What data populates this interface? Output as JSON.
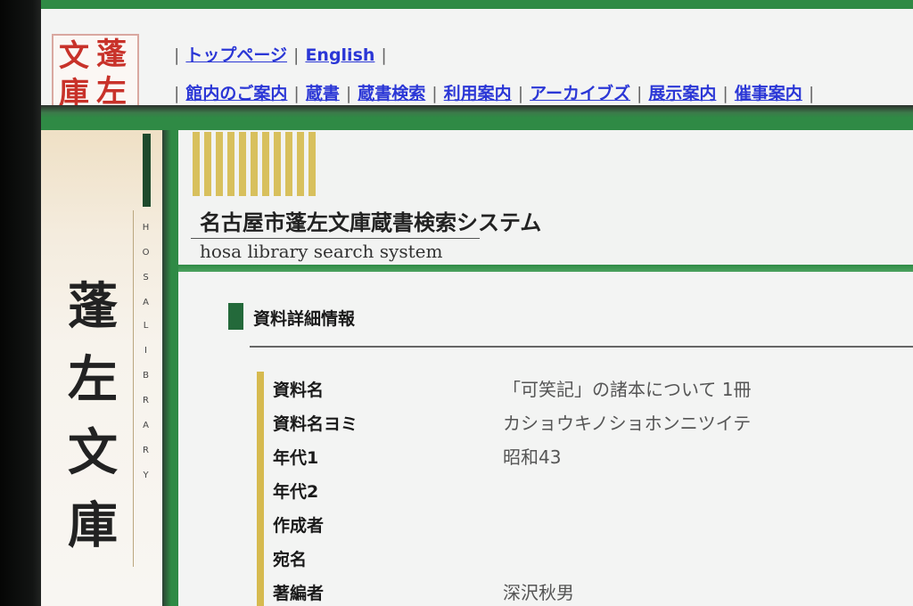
{
  "logo": {
    "chars": [
      "文",
      "蓬",
      "庫",
      "左"
    ]
  },
  "nav": {
    "top_links": [
      "トップページ",
      "English"
    ],
    "main_links": [
      "館内のご案内",
      "蔵書",
      "蔵書検索",
      "利用案内",
      "アーカイブズ",
      "展示案内",
      "催事案内"
    ]
  },
  "sidebar": {
    "vertical_text": [
      "H",
      "O",
      "S",
      "A",
      "L",
      "I",
      "B",
      "R",
      "A",
      "R",
      "Y"
    ],
    "kanji": [
      "蓬",
      "左",
      "文",
      "庫"
    ]
  },
  "system": {
    "title_jp": "名古屋市蓬左文庫蔵書検索システム",
    "title_en": "hosa library search system"
  },
  "section": {
    "title": "資料詳細情報"
  },
  "details": [
    {
      "label": "資料名",
      "value": "「可笑記」の諸本について 1冊"
    },
    {
      "label": "資料名ヨミ",
      "value": "カショウキノショホンニツイテ"
    },
    {
      "label": "年代1",
      "value": "昭和43"
    },
    {
      "label": "年代2",
      "value": ""
    },
    {
      "label": "作成者",
      "value": ""
    },
    {
      "label": "宛名",
      "value": ""
    },
    {
      "label": "著編者",
      "value": "深沢秋男"
    }
  ],
  "colors": {
    "accent_green": "#2f8a45",
    "link_blue": "#2b37d6",
    "gold": "#d6ba4f",
    "logo_red": "#c8322a"
  }
}
